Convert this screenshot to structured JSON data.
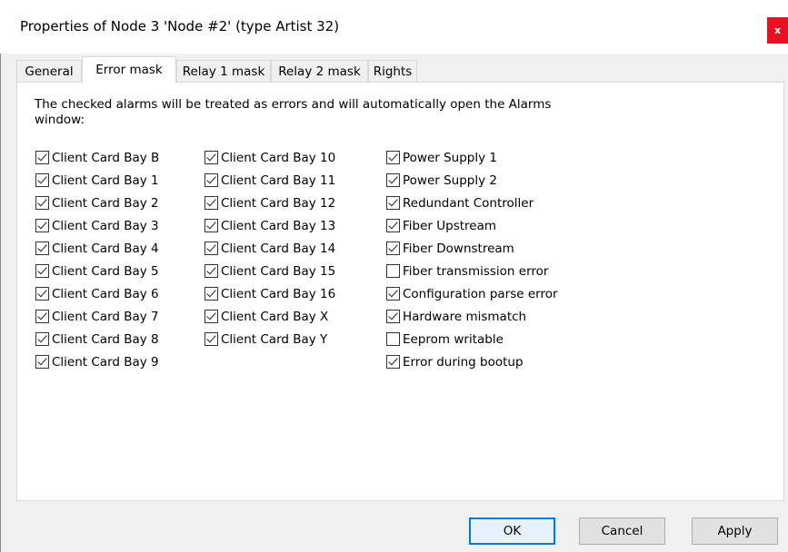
{
  "window": {
    "title": "Properties of Node 3 'Node #2' (type Artist 32)",
    "close_label": "x"
  },
  "tabs": [
    {
      "label": "General",
      "active": false
    },
    {
      "label": "Error mask",
      "active": true
    },
    {
      "label": "Relay 1 mask",
      "active": false
    },
    {
      "label": "Relay 2 mask",
      "active": false
    },
    {
      "label": "Rights",
      "active": false
    }
  ],
  "description": "The checked alarms will be treated as errors and will automatically open the Alarms window:",
  "columns": [
    [
      {
        "label": "Client Card Bay B",
        "checked": true
      },
      {
        "label": "Client Card Bay 1",
        "checked": true
      },
      {
        "label": "Client Card Bay 2",
        "checked": true
      },
      {
        "label": "Client Card Bay 3",
        "checked": true
      },
      {
        "label": "Client Card Bay 4",
        "checked": true
      },
      {
        "label": "Client Card Bay 5",
        "checked": true
      },
      {
        "label": "Client Card Bay 6",
        "checked": true
      },
      {
        "label": "Client Card Bay 7",
        "checked": true
      },
      {
        "label": "Client Card Bay 8",
        "checked": true
      },
      {
        "label": "Client Card Bay 9",
        "checked": true
      }
    ],
    [
      {
        "label": "Client Card Bay 10",
        "checked": true
      },
      {
        "label": "Client Card Bay 11",
        "checked": true
      },
      {
        "label": "Client Card Bay 12",
        "checked": true
      },
      {
        "label": "Client Card Bay 13",
        "checked": true
      },
      {
        "label": "Client Card Bay 14",
        "checked": true
      },
      {
        "label": "Client Card Bay 15",
        "checked": true
      },
      {
        "label": "Client Card Bay 16",
        "checked": true
      },
      {
        "label": "Client Card Bay X",
        "checked": true
      },
      {
        "label": "Client Card Bay Y",
        "checked": true
      }
    ],
    [
      {
        "label": "Power Supply 1",
        "checked": true
      },
      {
        "label": "Power Supply 2",
        "checked": true
      },
      {
        "label": "Redundant Controller",
        "checked": true
      },
      {
        "label": "Fiber Upstream",
        "checked": true
      },
      {
        "label": "Fiber Downstream",
        "checked": true
      },
      {
        "label": "Fiber transmission error",
        "checked": false
      },
      {
        "label": "Configuration parse error",
        "checked": true
      },
      {
        "label": "Hardware mismatch",
        "checked": true
      },
      {
        "label": "Eeprom writable",
        "checked": false
      },
      {
        "label": "Error during bootup",
        "checked": true
      }
    ]
  ],
  "buttons": {
    "ok": "OK",
    "cancel": "Cancel",
    "apply": "Apply"
  },
  "colors": {
    "accent": "#0078d7",
    "close": "#e81123",
    "dialog_bg": "#f0f0f0"
  }
}
